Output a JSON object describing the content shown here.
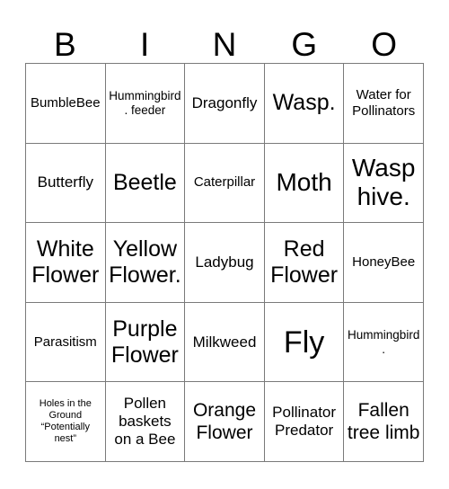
{
  "card": {
    "title_letters": [
      "B",
      "I",
      "N",
      "G",
      "O"
    ],
    "grid_size": "5x5",
    "colors": {
      "background": "#ffffff",
      "text": "#000000",
      "border": "#7a7a7a"
    }
  },
  "cells": [
    {
      "text": "BumbleBee",
      "size": "md"
    },
    {
      "text": "Hummingbird. feeder",
      "size": "sm"
    },
    {
      "text": "Dragonfly",
      "size": "lg"
    },
    {
      "text": "Wasp.",
      "size": "2xl"
    },
    {
      "text": "Water for Pollinators",
      "size": "md"
    },
    {
      "text": "Butterfly",
      "size": "lg"
    },
    {
      "text": "Beetle",
      "size": "2xl"
    },
    {
      "text": "Caterpillar",
      "size": "md"
    },
    {
      "text": "Moth",
      "size": "3xl"
    },
    {
      "text": "Wasp hive.",
      "size": "3xl"
    },
    {
      "text": "White Flower",
      "size": "2xl"
    },
    {
      "text": "Yellow Flower.",
      "size": "2xl"
    },
    {
      "text": "Ladybug",
      "size": "lg"
    },
    {
      "text": "Red Flower",
      "size": "2xl"
    },
    {
      "text": "HoneyBee",
      "size": "md"
    },
    {
      "text": "Parasitism",
      "size": "md"
    },
    {
      "text": "Purple Flower",
      "size": "2xl"
    },
    {
      "text": "Milkweed",
      "size": "lg"
    },
    {
      "text": "Fly",
      "size": "4xl"
    },
    {
      "text": "Hummingbird.",
      "size": "sm"
    },
    {
      "text": "Holes in the Ground “Potentially nest”",
      "size": "xs"
    },
    {
      "text": "Pollen baskets on a Bee",
      "size": "lg"
    },
    {
      "text": "Orange Flower",
      "size": "xl"
    },
    {
      "text": "Pollinator Predator",
      "size": "lg"
    },
    {
      "text": "Fallen tree limb",
      "size": "xl"
    }
  ]
}
